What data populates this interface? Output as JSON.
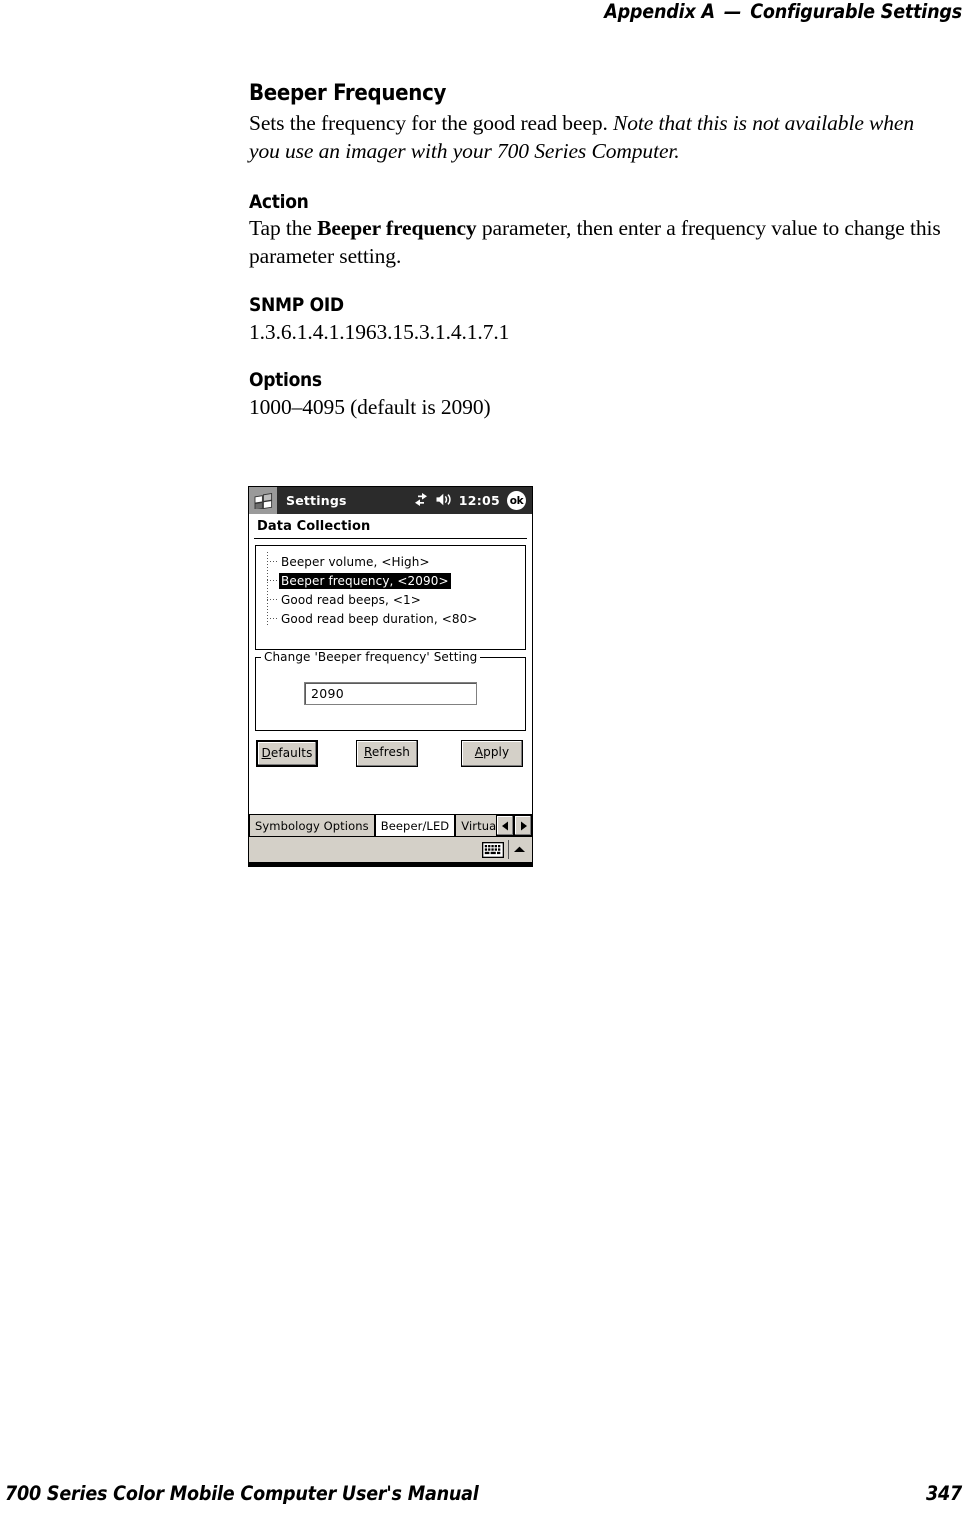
{
  "page": {
    "running_head_left": "Appendix A",
    "running_head_sep": "—",
    "running_head_right": "Configurable Settings",
    "footer_title": "700 Series Color Mobile Computer User's Manual",
    "footer_page_number": "347"
  },
  "sections": {
    "main_heading": "Beeper Frequency",
    "intro_plain": "Sets the frequency for the good read beep. ",
    "intro_note": "Note that this is not available when you use an imager with your 700 Series Computer.",
    "action_heading": "Action",
    "action_part1": "Tap the ",
    "action_bold": "Beeper frequency",
    "action_part2": " parameter, then enter a frequency value to change this parameter setting.",
    "snmp_heading": "SNMP OID",
    "snmp_value": "1.3.6.1.4.1.1963.15.3.1.4.1.7.1",
    "options_heading": "Options",
    "options_value": "1000–4095 (default is 2090)"
  },
  "device": {
    "titlebar": {
      "start_icon": "windows-flag-icon",
      "title": "Settings",
      "connectivity_icon": "network-connectivity-icon",
      "volume_icon": "speaker-icon",
      "clock": "12:05",
      "ok_label": "ok"
    },
    "page_title": "Data Collection",
    "tree_items": [
      {
        "label": "Beeper volume, <High>",
        "selected": false
      },
      {
        "label": "Beeper frequency, <2090>",
        "selected": true
      },
      {
        "label": "Good read beeps, <1>",
        "selected": false
      },
      {
        "label": "Good read beep duration, <80>",
        "selected": false
      }
    ],
    "group": {
      "legend": "Change 'Beeper frequency' Setting",
      "input_value": "2090"
    },
    "buttons": [
      {
        "accel": "D",
        "rest": "efaults",
        "focused": true
      },
      {
        "accel": "R",
        "rest": "efresh",
        "focused": false
      },
      {
        "accel": "A",
        "rest": "pply",
        "focused": false
      }
    ],
    "tabs": [
      {
        "label": "Symbology Options",
        "active": false
      },
      {
        "label": "Beeper/LED",
        "active": true
      },
      {
        "label": "Virtual W",
        "active": false
      }
    ],
    "tab_scroll": {
      "left_icon": "triangle-left-icon",
      "right_icon": "triangle-right-icon"
    },
    "sip": {
      "keyboard_icon": "keyboard-icon",
      "expand_icon": "chevron-up-icon"
    }
  },
  "colors": {
    "titlebar_bg": "#2b2b2b",
    "start_bg": "#9a9a9a",
    "chrome_face": "#d4d0c8",
    "selection_bg": "#000000",
    "page_bg": "#ffffff"
  }
}
